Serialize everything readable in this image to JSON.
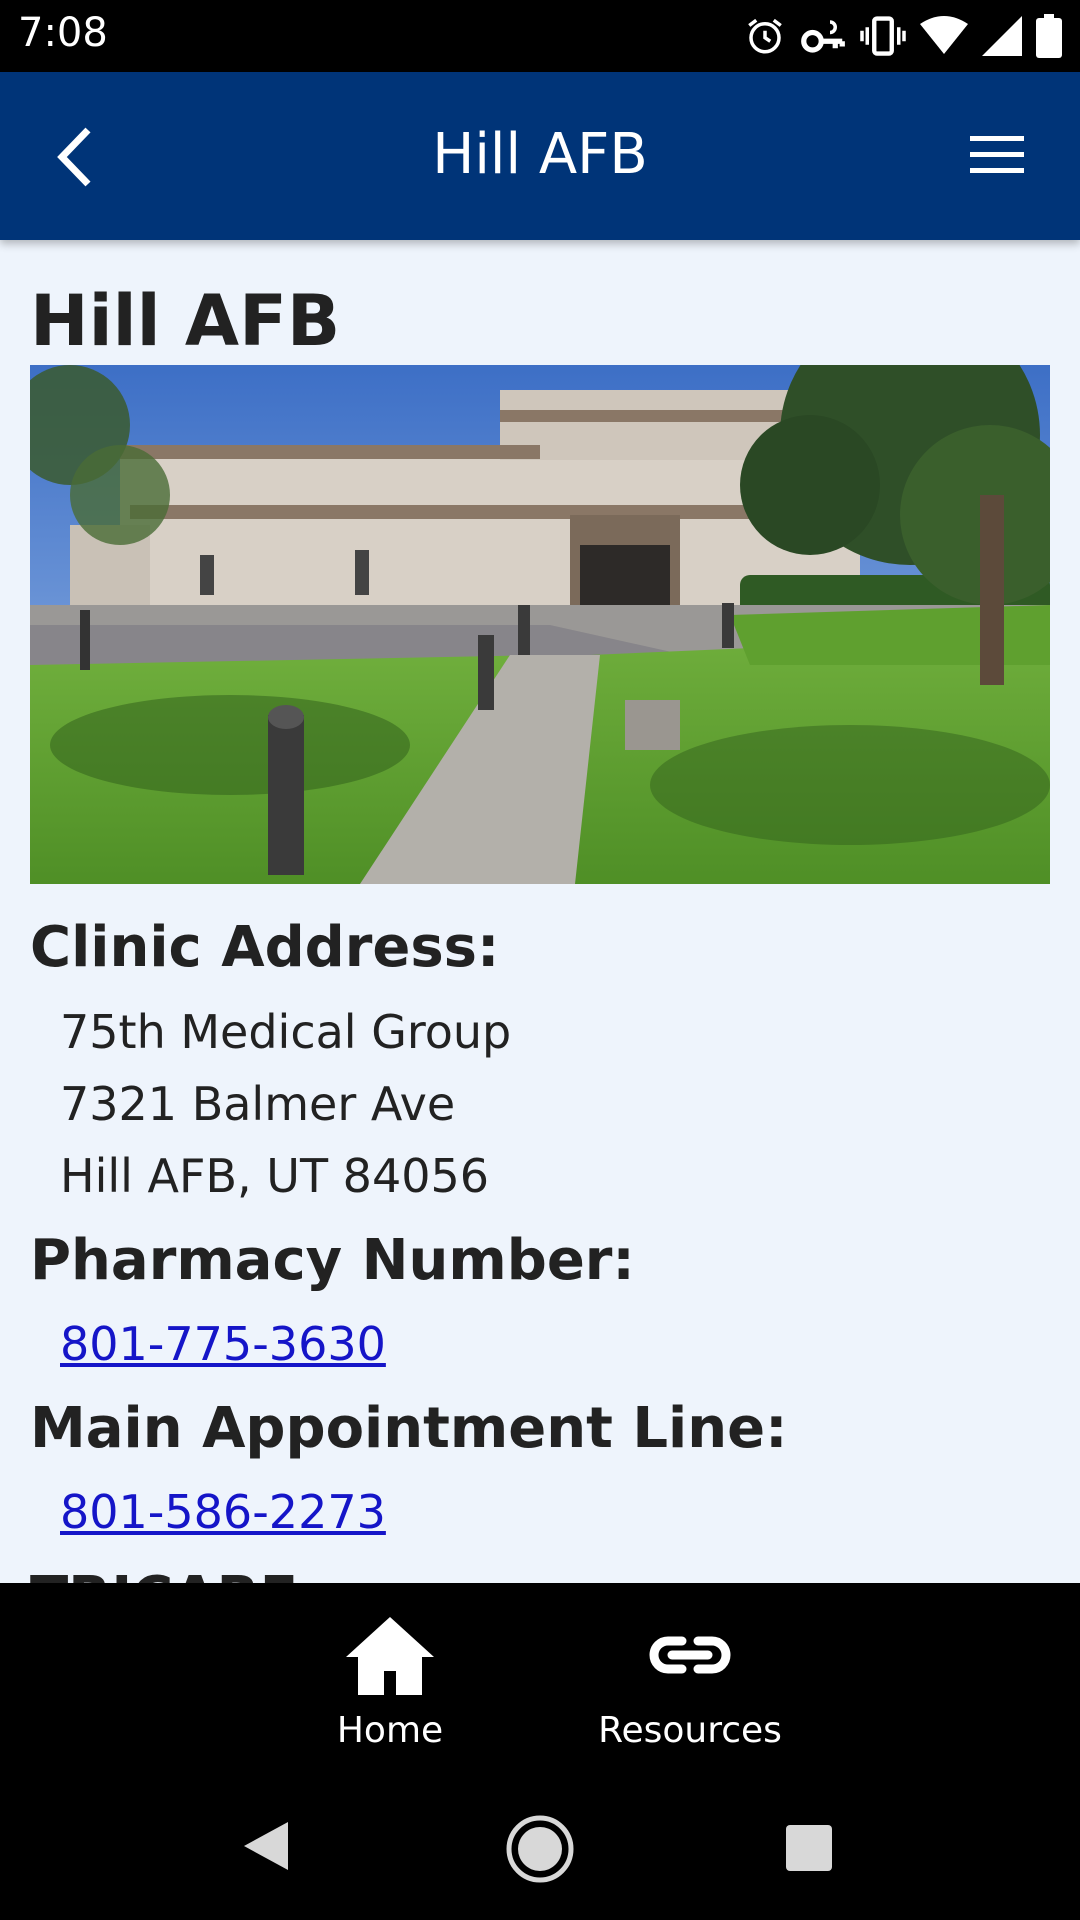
{
  "status_bar": {
    "time": "7:08",
    "icons": [
      "alarm-icon",
      "vpn-key-icon",
      "vibrate-icon",
      "wifi-icon",
      "signal-icon",
      "battery-icon"
    ]
  },
  "app_bar": {
    "title": "Hill AFB",
    "back_icon": "chevron-left-icon",
    "menu_icon": "hamburger-menu-icon",
    "background_color": "#003478"
  },
  "page": {
    "title": "Hill AFB",
    "photo_alt": "clinic-building-photo",
    "clinic_address": {
      "heading": "Clinic Address:",
      "lines": [
        "75th Medical Group",
        "7321 Balmer Ave",
        "Hill AFB, UT 84056"
      ]
    },
    "pharmacy": {
      "heading": "Pharmacy Number:",
      "phone": "801-775-3630"
    },
    "appointment": {
      "heading": "Main Appointment Line:",
      "phone": "801-586-2273"
    },
    "partial_heading": "TRICARE"
  },
  "bottom_nav": {
    "items": [
      {
        "label": "Home",
        "icon": "home-icon"
      },
      {
        "label": "Resources",
        "icon": "link-icon"
      }
    ]
  },
  "system_nav": {
    "icons": [
      "back-triangle-icon",
      "home-circle-icon",
      "recents-square-icon"
    ]
  }
}
